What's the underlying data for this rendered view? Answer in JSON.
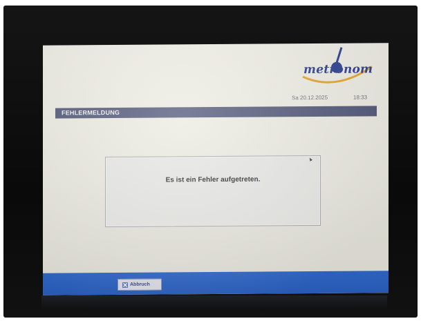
{
  "header": {
    "logo_text": "metronom",
    "date": "Sa 20.12.2025",
    "time": "18:33"
  },
  "title_bar": {
    "title": "FEHLERMELDUNG"
  },
  "message": {
    "text": "Es ist ein Fehler aufgetreten."
  },
  "footer": {
    "abort_label": "Abbruch",
    "abort_icon": "close-icon"
  },
  "colors": {
    "title_bar": "#505677",
    "footer_bar": "#2f67c8",
    "logo_blue": "#2c3f8f",
    "logo_swoosh": "#e3a32a"
  }
}
